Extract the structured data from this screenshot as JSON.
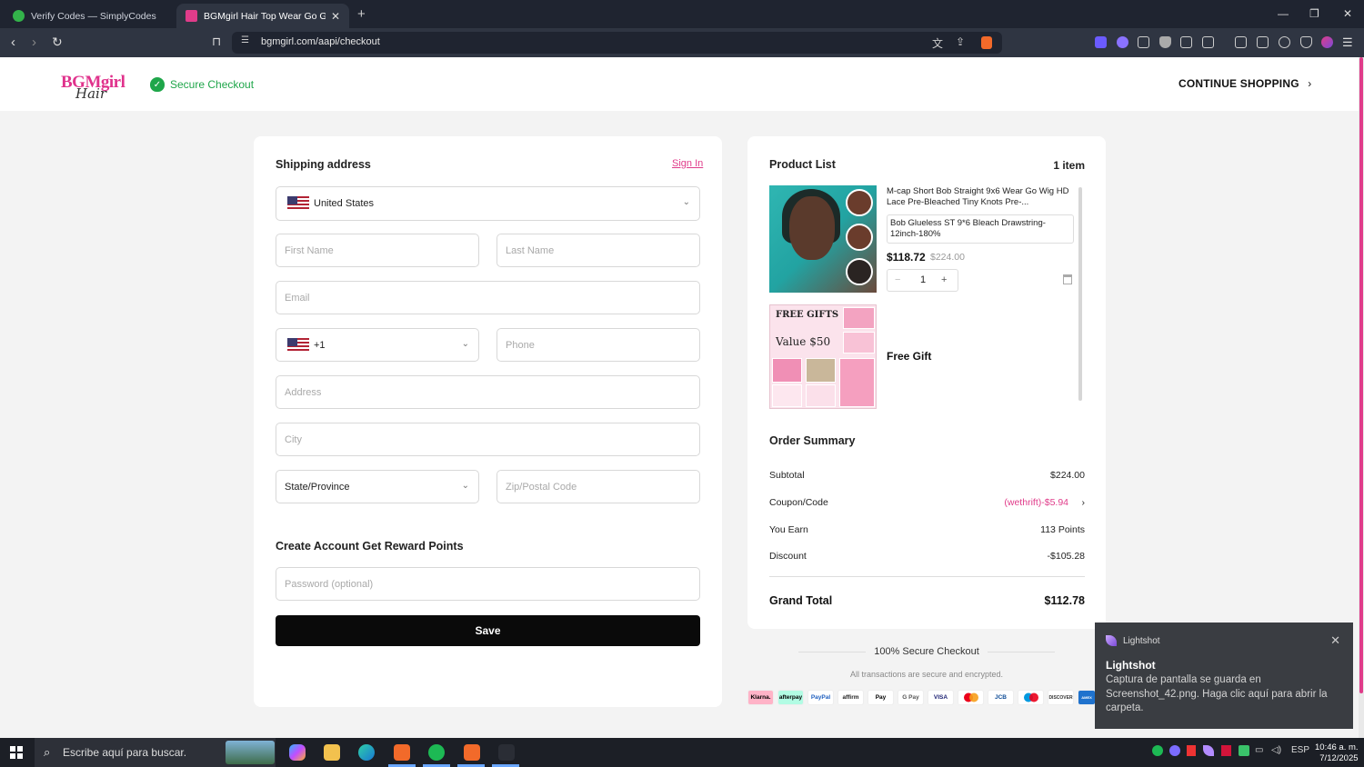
{
  "browser": {
    "tabs": [
      {
        "title": "Verify Codes — SimplyCodes"
      },
      {
        "title": "BGMgirl Hair Top Wear Go Glueless"
      }
    ],
    "url": "bgmgirl.com/aapi/checkout"
  },
  "header": {
    "logo_top": "BGMgirl",
    "logo_bottom": "Hair",
    "secure_label": "Secure Checkout",
    "continue_label": "CONTINUE SHOPPING"
  },
  "shipping": {
    "title": "Shipping address",
    "sign_in": "Sign In",
    "country": "United States",
    "first_name_ph": "First Name",
    "last_name_ph": "Last Name",
    "email_ph": "Email",
    "phone_code": "+1",
    "phone_ph": "Phone",
    "address_ph": "Address",
    "city_ph": "City",
    "state": "State/Province",
    "zip_ph": "Zip/Postal Code",
    "account_title": "Create Account Get Reward Points",
    "password_ph": "Password (optional)",
    "save_label": "Save"
  },
  "products": {
    "title": "Product List",
    "count": "1 item",
    "item": {
      "name": "M-cap Short Bob Straight 9x6 Wear Go Wig HD Lace Pre-Bleached Tiny Knots Pre-...",
      "variant": "Bob Glueless ST 9*6 Bleach Drawstring-12inch-180%",
      "price": "$118.72",
      "old_price": "$224.00",
      "qty": "1"
    },
    "gift_banner_title": "FREE GIFTS",
    "gift_banner_value": "Value $50",
    "gift_label": "Free Gift"
  },
  "summary": {
    "title": "Order Summary",
    "rows": [
      {
        "label": "Subtotal",
        "value": "$224.00"
      },
      {
        "label": "Coupon/Code",
        "value": "(wethrift)-$5.94"
      },
      {
        "label": "You Earn",
        "value": "113 Points"
      },
      {
        "label": "Discount",
        "value": "-$105.28"
      }
    ],
    "grand_label": "Grand Total",
    "grand_value": "$112.78",
    "secure_text": "100% Secure Checkout",
    "encrypt_text": "All transactions are secure and encrypted.",
    "payments": [
      "Klarna.",
      "afterpay",
      "PayPal",
      "affirm",
      "Pay",
      "G Pay",
      "VISA",
      "",
      "JCB",
      "",
      "DISCOVER",
      "AMEX"
    ]
  },
  "notification": {
    "app": "Lightshot",
    "title": "Lightshot",
    "message": "Captura de pantalla se guarda en Screenshot_42.png. Haga clic aquí para abrir la carpeta."
  },
  "taskbar": {
    "search_placeholder": "Escribe aquí para buscar.",
    "lang": "ESP",
    "time": "10:46 a. m.",
    "date": "7/12/2025"
  },
  "colors": {
    "accent": "#e03c8a",
    "secure_green": "#1fa64a"
  }
}
